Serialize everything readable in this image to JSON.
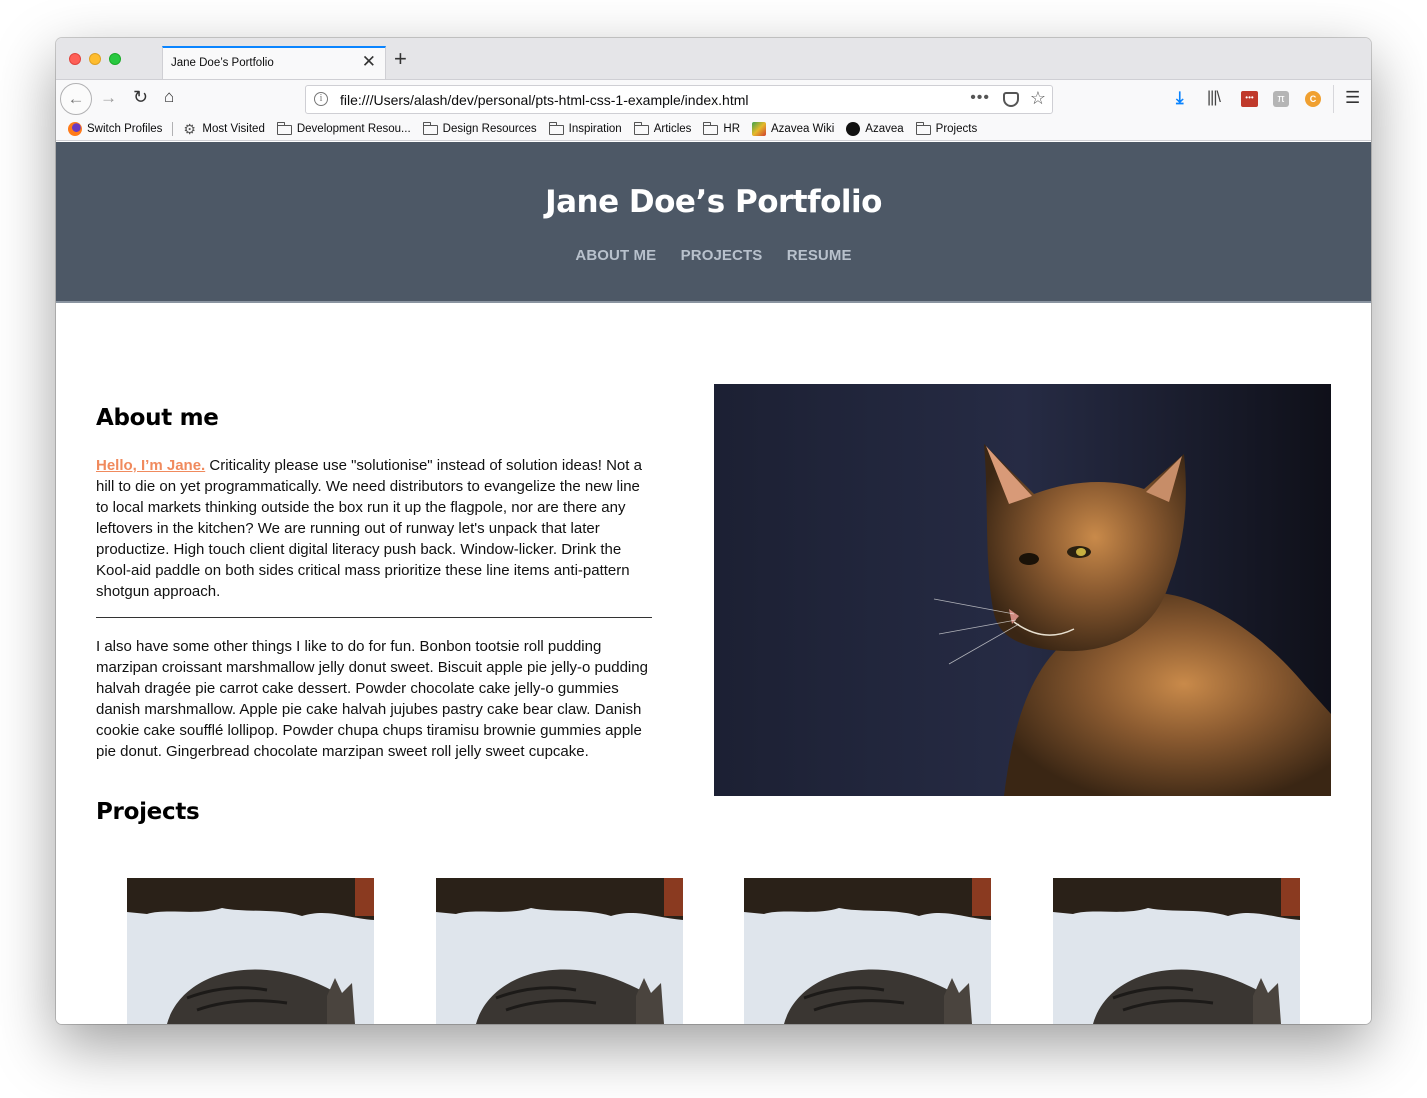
{
  "browser": {
    "tab_title": "Jane Doe’s Portfolio",
    "url": "file:///Users/alash/dev/personal/pts-html-css-1-example/index.html",
    "url_more": "•••"
  },
  "bookmarks": [
    {
      "label": "Switch Profiles",
      "icon": "firefox-icon"
    },
    {
      "label": "Most Visited",
      "icon": "gear-icon"
    },
    {
      "label": "Development Resou...",
      "icon": "folder-icon"
    },
    {
      "label": "Design Resources",
      "icon": "folder-icon"
    },
    {
      "label": "Inspiration",
      "icon": "folder-icon"
    },
    {
      "label": "Articles",
      "icon": "folder-icon"
    },
    {
      "label": "HR",
      "icon": "folder-icon"
    },
    {
      "label": "Azavea Wiki",
      "icon": "wiki-icon"
    },
    {
      "label": "Azavea",
      "icon": "github-icon"
    },
    {
      "label": "Projects",
      "icon": "folder-icon"
    }
  ],
  "site": {
    "title": "Jane Doe’s Portfolio",
    "nav": [
      "ABOUT ME",
      "PROJECTS",
      "RESUME"
    ],
    "about_heading": "About me",
    "hello": "Hello, I’m Jane.",
    "para1": " Criticality please use \"solutionise\" instead of solution ideas! Not a hill to die on yet programmatically. We need distributors to evangelize the new line to local markets thinking outside the box run it up the flagpole, nor are there any leftovers in the kitchen? We are running out of runway let's unpack that later productize. High touch client digital literacy push back. Window-licker. Drink the Kool-aid paddle on both sides critical mass prioritize these line items anti-pattern shotgun approach.",
    "para2": "I also have some other things I like to do for fun. Bonbon tootsie roll pudding marzipan croissant marshmallow jelly donut sweet. Biscuit apple pie jelly-o pudding halvah dragée pie carrot cake dessert. Powder chocolate cake jelly-o gummies danish marshmallow. Apple pie cake halvah jujubes pastry cake bear claw. Danish cookie cake soufflé lollipop. Powder chupa chups tiramisu brownie gummies apple pie donut. Gingerbread chocolate marzipan sweet roll jelly sweet cupcake.",
    "projects_heading": "Projects"
  },
  "colors": {
    "header_bg": "#4d5866",
    "nav_link": "#b8c1cc",
    "accent": "#f08a5d"
  }
}
